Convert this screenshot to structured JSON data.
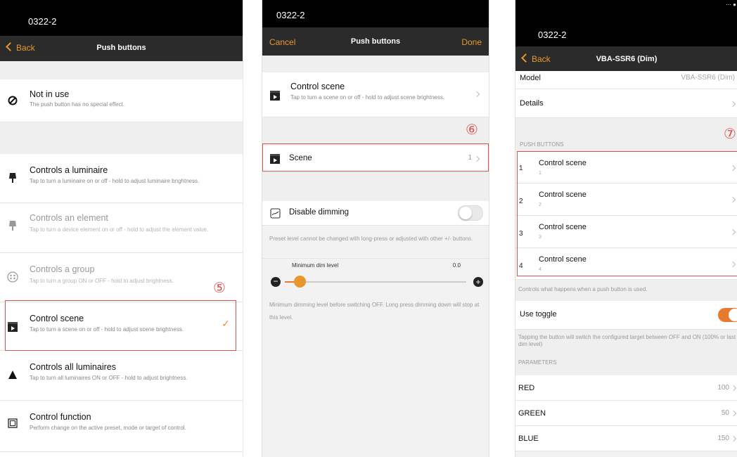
{
  "p1": {
    "device": "0322-2",
    "back": "Back",
    "title": "Push buttons",
    "marker": "⑤",
    "items": [
      {
        "title": "Not in use",
        "desc": "The push button has no special effect."
      },
      {
        "title": "Controls a luminaire",
        "desc": "Tap to turn a luminaire on or off - hold to adjust luminaire brightness."
      },
      {
        "title": "Controls an element",
        "desc": "Tap to turn a device element on or off - hold to adjust the element value."
      },
      {
        "title": "Controls a group",
        "desc": "Tap to turn a group ON or OFF - hold to adjust brightness."
      },
      {
        "title": "Control scene",
        "desc": "Tap to turn a scene on or off - hold to adjust scene brightness."
      },
      {
        "title": "Controls all luminaires",
        "desc": "Tap to turn all luminaires ON or OFF - hold to adjust brightness."
      },
      {
        "title": "Control function",
        "desc": "Perform change on the active preset, mode or target of control."
      }
    ],
    "checkmark": "✓"
  },
  "p2": {
    "device": "0322-2",
    "cancel": "Cancel",
    "title": "Push buttons",
    "done": "Done",
    "marker": "⑥",
    "control_scene_title": "Control scene",
    "control_scene_desc": "Tap to turn a scene on or off - hold to adjust scene brightness.",
    "scene_label": "Scene",
    "scene_value": "1",
    "disable_dimming": "Disable dimming",
    "disable_dimming_note": "Preset level cannot be changed with long-press or adjusted with other +/- buttons.",
    "min_dim_label": "Minimum dim level",
    "min_dim_value": "0.0",
    "min_dim_fraction": 0.08,
    "min_dim_note": "Minimum dimming level before switching OFF. Long press dimming down will stop at this level."
  },
  "p3": {
    "device": "0322-2",
    "back": "Back",
    "title": "VBA-SSR6 (Dim)",
    "marker": "⑦",
    "model_label": "Model",
    "model_value": "VBA-SSR6 (Dim)",
    "details_label": "Details",
    "push_buttons_header": "PUSH BUTTONS",
    "buttons": [
      {
        "num": "1",
        "title": "Control scene",
        "sub": "1"
      },
      {
        "num": "2",
        "title": "Control scene",
        "sub": "2"
      },
      {
        "num": "3",
        "title": "Control scene",
        "sub": "3"
      },
      {
        "num": "4",
        "title": "Control scene",
        "sub": "4"
      }
    ],
    "buttons_note": "Controls what happens when a push button is used.",
    "use_toggle": "Use toggle",
    "use_toggle_note": "Tapping the button will switch the configured target between OFF and ON (100% or last dim level)",
    "parameters_header": "PARAMETERS",
    "params": [
      {
        "label": "RED",
        "value": "100"
      },
      {
        "label": "GREEN",
        "value": "50"
      },
      {
        "label": "BLUE",
        "value": "150"
      }
    ]
  },
  "colors": {
    "accent": "#e8792e",
    "highlight": "#d9534f",
    "navbar": "#2b2b2b"
  }
}
